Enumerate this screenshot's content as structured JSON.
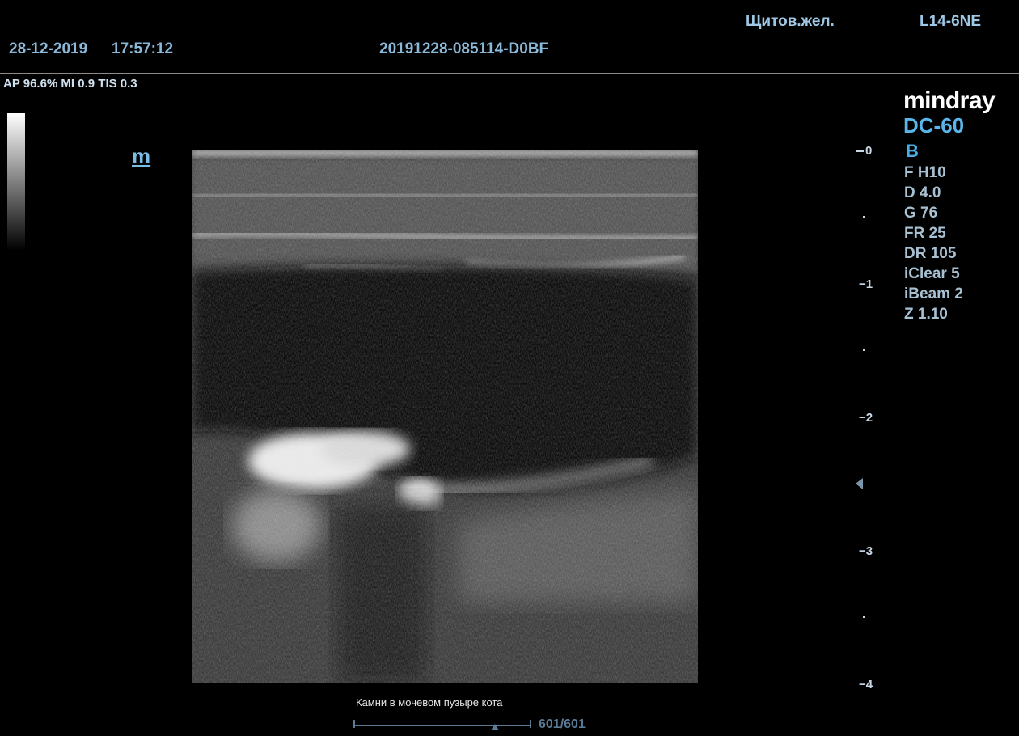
{
  "header": {
    "preset": "Щитов.жел.",
    "probe": "L14-6NE",
    "date": "28-12-2019",
    "time": "17:57:12",
    "exam_id": "20191228-085114-D0BF"
  },
  "acoustic": {
    "readout": "AP 96.6%  MI 0.9 TIS 0.3"
  },
  "device": {
    "brand": "mindray",
    "model": "DC-60"
  },
  "imaging": {
    "mode": "B",
    "params": [
      "F H10",
      "D 4.0",
      "G 76",
      "FR 25",
      "DR 105",
      "iClear 5",
      "iBeam 2",
      "Z 1.10"
    ]
  },
  "marker_label": "m",
  "depth_scale": {
    "labels": [
      "0",
      "1",
      "2",
      "3",
      "4"
    ],
    "unit_note": ""
  },
  "caption": "Камни в мочевом пузыре кота",
  "cine": {
    "counter": "601/601",
    "position": 1.0
  },
  "colors": {
    "header_text": "#8ab8d8",
    "brand_model": "#5ab6ea",
    "param_text": "#a7c0d2",
    "background": "#000000"
  }
}
